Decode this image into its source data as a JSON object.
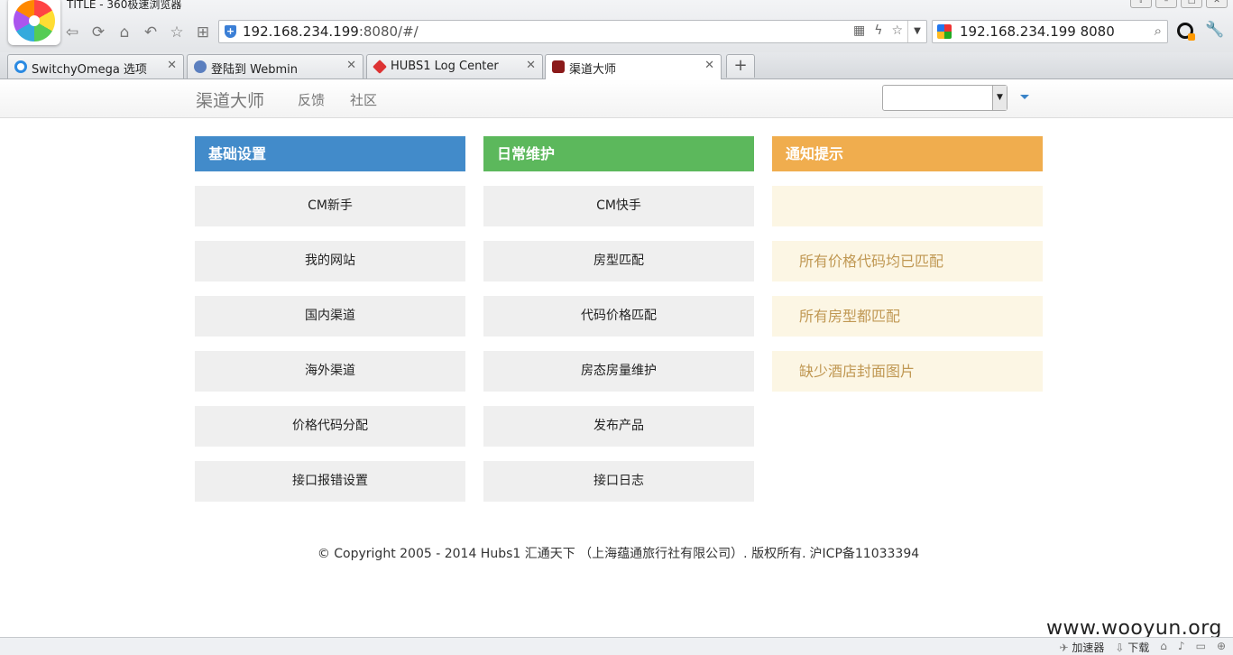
{
  "browser": {
    "window_title": "TITLE - 360极速浏览器",
    "address": {
      "host": "192.168.234.199",
      "rest": ":8080/#/"
    },
    "search_text": "192.168.234.199 8080",
    "tabs": [
      {
        "label": "SwitchyOmega 选项",
        "icon_color": "#2b8ae2"
      },
      {
        "label": "登陆到 Webmin",
        "icon_color": "#5b7fbf"
      },
      {
        "label": "HUBS1 Log Center",
        "icon_color": "#d33"
      },
      {
        "label": "渠道大师",
        "icon_color": "#8b1a1a"
      }
    ],
    "status": {
      "accelerator": "加速器",
      "download": "下载"
    }
  },
  "site": {
    "brand": "渠道大师",
    "nav": [
      "反馈",
      "社区"
    ],
    "columns": [
      {
        "title": "基础设置",
        "color": "#428bca",
        "items": [
          "CM新手",
          "我的网站",
          "国内渠道",
          "海外渠道",
          "价格代码分配",
          "接口报错设置"
        ]
      },
      {
        "title": "日常维护",
        "color": "#5cb85c",
        "items": [
          "CM快手",
          "房型匹配",
          "代码价格匹配",
          "房态房量维护",
          "发布产品",
          "接口日志"
        ]
      },
      {
        "title": "通知提示",
        "color": "#f0ad4e",
        "items": [
          "",
          "所有价格代码均已匹配",
          "所有房型都匹配",
          "缺少酒店封面图片"
        ]
      }
    ],
    "footer": {
      "copyright": "© Copyright 2005 - 2014 Hubs1 汇通天下 （上海蕴通旅行社有限公司）. 版权所有.",
      "icp": "沪ICP备11033394"
    }
  },
  "watermark": "www.wooyun.org"
}
